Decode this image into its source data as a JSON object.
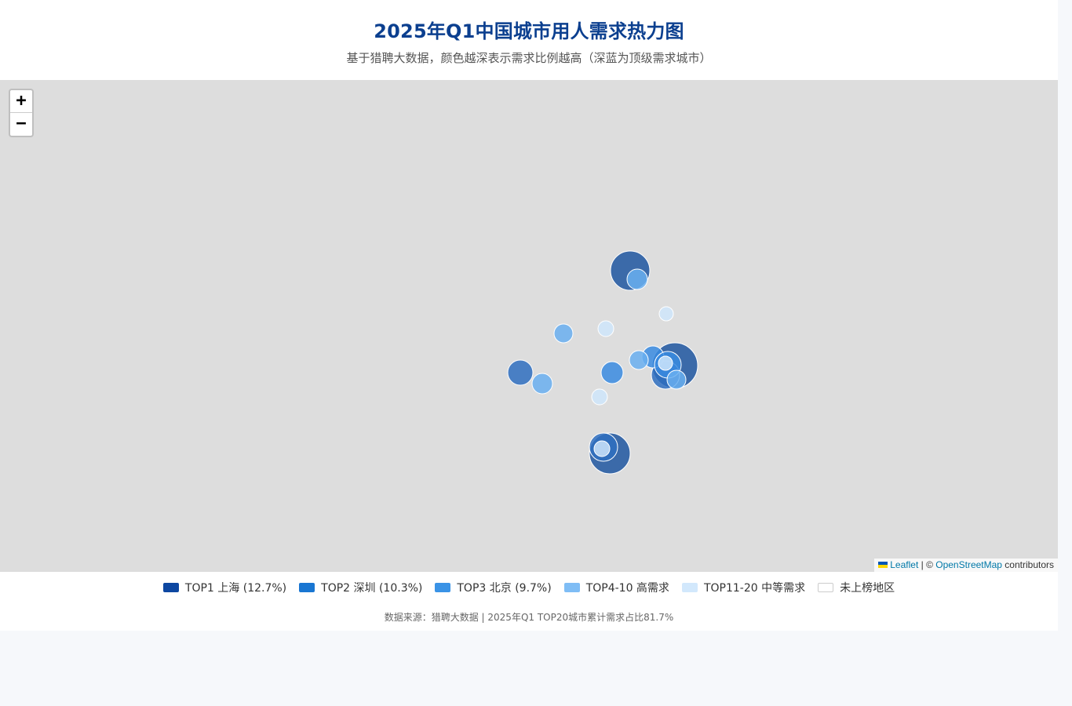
{
  "header": {
    "title": "2025年Q1中国城市用人需求热力图",
    "subtitle": "基于猎聘大数据，颜色越深表示需求比例越高（深蓝为顶级需求城市）"
  },
  "map": {
    "zoom_in_label": "+",
    "zoom_out_label": "−",
    "attribution": {
      "leaflet_link": "Leaflet",
      "separator": " | © ",
      "osm_link": "OpenStreetMap",
      "suffix": " contributors"
    },
    "markers": [
      {
        "tier": "top1",
        "color": "#1f56a0"
      },
      {
        "tier": "top1",
        "color": "#1f56a0"
      },
      {
        "tier": "top1",
        "color": "#1f56a0"
      },
      {
        "tier": "top2",
        "color": "#2f6fc0"
      },
      {
        "tier": "top2",
        "color": "#2f6fc0"
      },
      {
        "tier": "top3",
        "color": "#3a8be0"
      },
      {
        "tier": "top3",
        "color": "#3a8be0"
      },
      {
        "tier": "top3",
        "color": "#3a8be0"
      },
      {
        "tier": "top4-10",
        "color": "#6aaff0"
      },
      {
        "tier": "top4-10",
        "color": "#6aaff0"
      },
      {
        "tier": "top4-10",
        "color": "#6aaff0"
      },
      {
        "tier": "top4-10",
        "color": "#6aaff0"
      },
      {
        "tier": "top4-10",
        "color": "#6aaff0"
      },
      {
        "tier": "top11-20",
        "color": "#cfe6fb"
      },
      {
        "tier": "top11-20",
        "color": "#cfe6fb"
      },
      {
        "tier": "top11-20",
        "color": "#cfe6fb"
      },
      {
        "tier": "top11-20",
        "color": "#cfe6fb"
      },
      {
        "tier": "top11-20",
        "color": "#cfe6fb"
      }
    ]
  },
  "legend": [
    {
      "label": "TOP1 上海 (12.7%)",
      "color": "#0d47a1"
    },
    {
      "label": "TOP2 深圳 (10.3%)",
      "color": "#1976d2"
    },
    {
      "label": "TOP3 北京 (9.7%)",
      "color": "#3a93e6"
    },
    {
      "label": "TOP4-10 高需求",
      "color": "#7fbdf5"
    },
    {
      "label": "TOP11-20 中等需求",
      "color": "#d2e8fc"
    },
    {
      "label": "未上榜地区",
      "color": "#ffffff"
    }
  ],
  "footer": "数据来源：猎聘大数据 | 2025年Q1 TOP20城市累计需求占比81.7%"
}
